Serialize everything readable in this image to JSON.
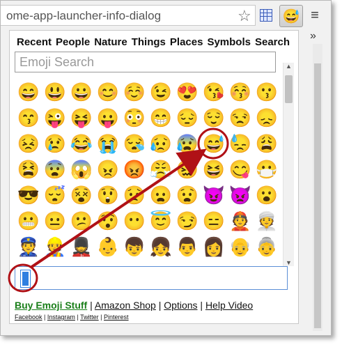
{
  "browser": {
    "url_text": "ome-app-launcher-info-dialog",
    "menu_icon": "menu-icon"
  },
  "popup": {
    "tabs": [
      "Recent",
      "People",
      "Nature",
      "Things",
      "Places",
      "Symbols",
      "Search"
    ],
    "search_placeholder": "Emoji Search",
    "emoji_rows": [
      [
        "😄",
        "😃",
        "😀",
        "😊",
        "☺️",
        "😉",
        "😍",
        "😘",
        "😚",
        "😗"
      ],
      [
        "😙",
        "😜",
        "😝",
        "😛",
        "😳",
        "😁",
        "😔",
        "😌",
        "😒",
        "😞"
      ],
      [
        "😣",
        "😢",
        "😂",
        "😭",
        "😪",
        "😥",
        "😰",
        "😅",
        "😓",
        "😩"
      ],
      [
        "😫",
        "😨",
        "😱",
        "😠",
        "😡",
        "😤",
        "😖",
        "😆",
        "😋",
        "😷"
      ],
      [
        "😎",
        "😴",
        "😵",
        "😲",
        "😟",
        "😦",
        "😧",
        "😈",
        "👿",
        "😮"
      ],
      [
        "😬",
        "😐",
        "😕",
        "😯",
        "😶",
        "😇",
        "😏",
        "😑",
        "👲",
        "👳"
      ],
      [
        "👮",
        "👷",
        "💂",
        "👶",
        "👦",
        "👧",
        "👨",
        "👩",
        "👴",
        "👵"
      ]
    ],
    "links": {
      "buy": "Buy Emoji Stuff",
      "amazon": "Amazon Shop",
      "options": "Options",
      "help": "Help Video",
      "sep": "|"
    },
    "sublinks": {
      "facebook": "Facebook",
      "instagram": "Instagram",
      "twitter": "Twitter",
      "pinterest": "Pinterest",
      "sep": "|"
    }
  },
  "colors": {
    "annotation": "#b01116",
    "buy_link": "#1a7f1a",
    "focus_border": "#5b8fd6"
  }
}
